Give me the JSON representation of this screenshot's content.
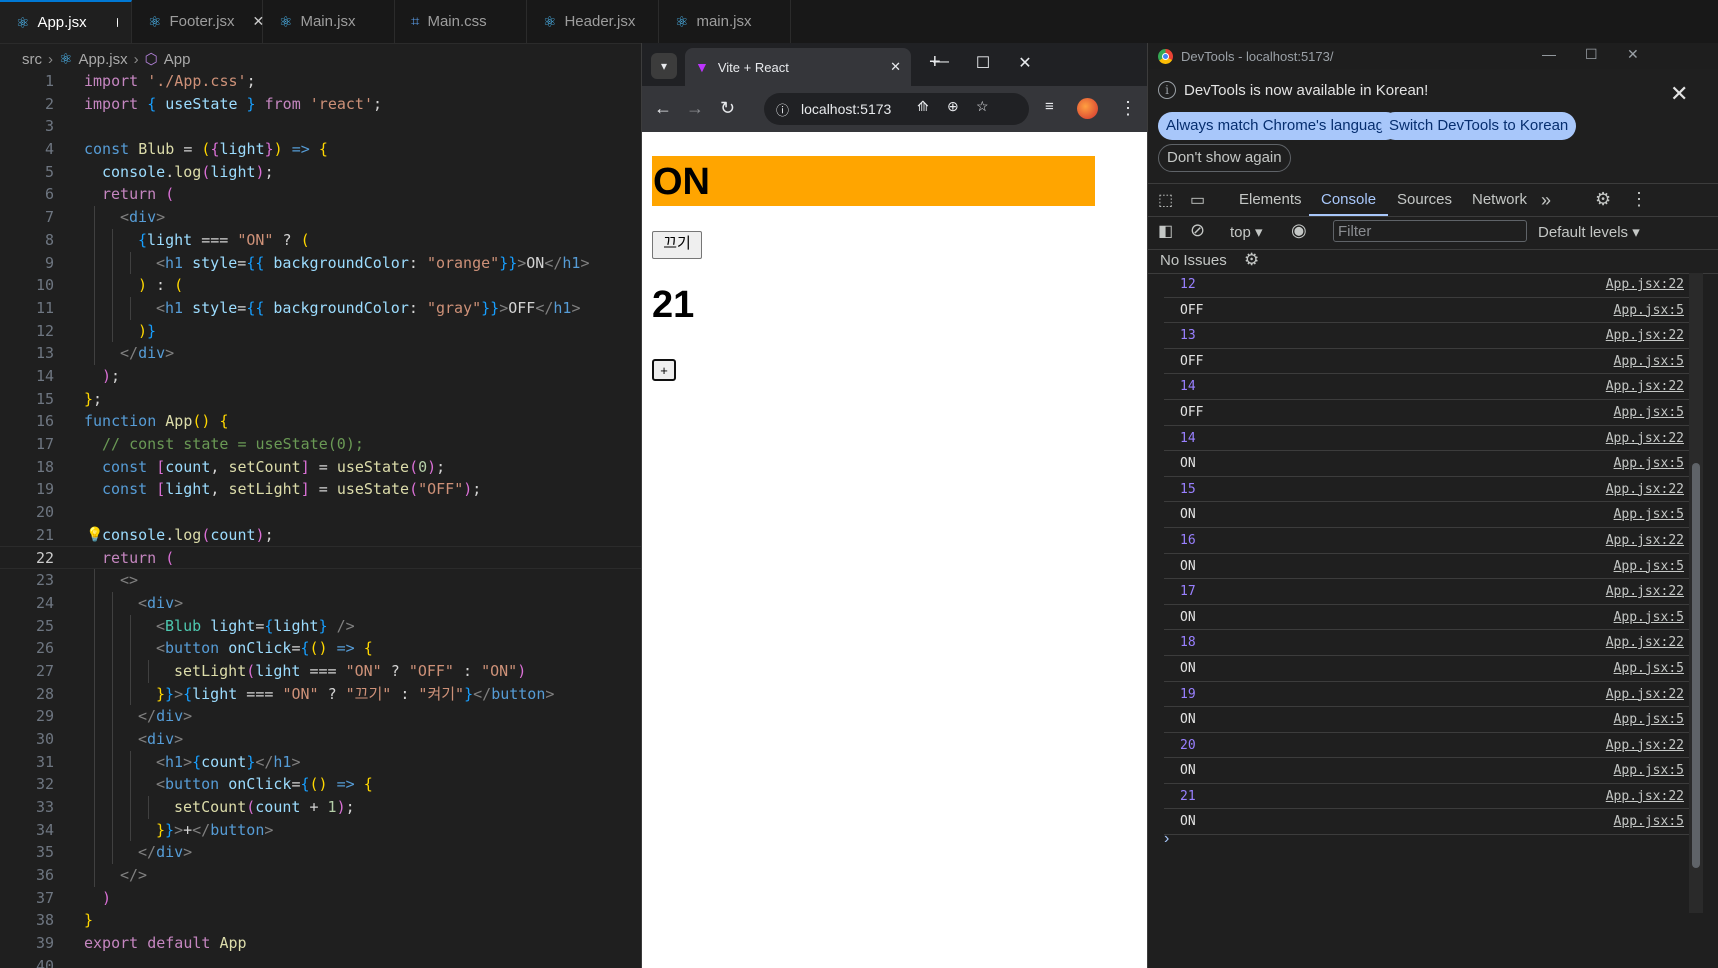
{
  "editor": {
    "tabs": [
      {
        "label": "App.jsx",
        "icon": "react-icon",
        "active": true,
        "modified": true
      },
      {
        "label": "Footer.jsx",
        "icon": "react-icon",
        "close": true
      },
      {
        "label": "Main.jsx",
        "icon": "react-icon"
      },
      {
        "label": "Main.css",
        "icon": "css-icon"
      },
      {
        "label": "Header.jsx",
        "icon": "react-icon"
      },
      {
        "label": "main.jsx",
        "icon": "react-icon"
      }
    ],
    "breadcrumb": {
      "folder": "src",
      "file": "App.jsx",
      "symbol": "App"
    },
    "current_line": 22,
    "lines": [
      {
        "n": 1,
        "i": 0,
        "t": [
          [
            "import ",
            "c"
          ],
          [
            "'./App.css'",
            "s"
          ],
          [
            ";",
            "d"
          ]
        ]
      },
      {
        "n": 2,
        "i": 0,
        "t": [
          [
            "import ",
            "c"
          ],
          [
            "{ ",
            "b"
          ],
          [
            "useState",
            "v"
          ],
          [
            " }",
            "b"
          ],
          [
            " from ",
            "c"
          ],
          [
            "'react'",
            "s"
          ],
          [
            ";",
            "d"
          ]
        ]
      },
      {
        "n": 3,
        "i": 0,
        "t": []
      },
      {
        "n": 4,
        "i": 0,
        "t": [
          [
            "const ",
            "k"
          ],
          [
            "Blub",
            "f"
          ],
          [
            " = ",
            "d"
          ],
          [
            "(",
            "p"
          ],
          [
            "{",
            "q"
          ],
          [
            "light",
            "v"
          ],
          [
            "}",
            "q"
          ],
          [
            ")",
            "p"
          ],
          [
            " => ",
            "k"
          ],
          [
            "{",
            "p"
          ]
        ]
      },
      {
        "n": 5,
        "i": 1,
        "t": [
          [
            "console",
            "v"
          ],
          [
            ".",
            "d"
          ],
          [
            "log",
            "f"
          ],
          [
            "(",
            "q"
          ],
          [
            "light",
            "v"
          ],
          [
            ")",
            "q"
          ],
          [
            ";",
            "d"
          ]
        ]
      },
      {
        "n": 6,
        "i": 1,
        "t": [
          [
            "return ",
            "c"
          ],
          [
            "(",
            "q"
          ]
        ]
      },
      {
        "n": 7,
        "i": 2,
        "t": [
          [
            "<",
            "g"
          ],
          [
            "div",
            "k"
          ],
          [
            ">",
            "g"
          ]
        ]
      },
      {
        "n": 8,
        "i": 3,
        "t": [
          [
            "{",
            "b"
          ],
          [
            "light",
            "v"
          ],
          [
            " === ",
            "d"
          ],
          [
            "\"ON\"",
            "s"
          ],
          [
            " ? ",
            "d"
          ],
          [
            "(",
            "p"
          ]
        ]
      },
      {
        "n": 9,
        "i": 4,
        "t": [
          [
            "<",
            "g"
          ],
          [
            "h1 ",
            "k"
          ],
          [
            "style",
            "v"
          ],
          [
            "=",
            "d"
          ],
          [
            "{{ ",
            "b"
          ],
          [
            "backgroundColor",
            "v"
          ],
          [
            ": ",
            "d"
          ],
          [
            "\"orange\"",
            "s"
          ],
          [
            "}}",
            "b"
          ],
          [
            ">",
            "g"
          ],
          [
            "ON",
            "d"
          ],
          [
            "</",
            "g"
          ],
          [
            "h1",
            "k"
          ],
          [
            ">",
            "g"
          ]
        ]
      },
      {
        "n": 10,
        "i": 3,
        "t": [
          [
            ")",
            "p"
          ],
          [
            " : ",
            "d"
          ],
          [
            "(",
            "p"
          ]
        ]
      },
      {
        "n": 11,
        "i": 4,
        "t": [
          [
            "<",
            "g"
          ],
          [
            "h1 ",
            "k"
          ],
          [
            "style",
            "v"
          ],
          [
            "=",
            "d"
          ],
          [
            "{{ ",
            "b"
          ],
          [
            "backgroundColor",
            "v"
          ],
          [
            ": ",
            "d"
          ],
          [
            "\"gray\"",
            "s"
          ],
          [
            "}}",
            "b"
          ],
          [
            ">",
            "g"
          ],
          [
            "OFF",
            "d"
          ],
          [
            "</",
            "g"
          ],
          [
            "h1",
            "k"
          ],
          [
            ">",
            "g"
          ]
        ]
      },
      {
        "n": 12,
        "i": 3,
        "t": [
          [
            ")",
            "p"
          ],
          [
            "}",
            "b"
          ]
        ]
      },
      {
        "n": 13,
        "i": 2,
        "t": [
          [
            "</",
            "g"
          ],
          [
            "div",
            "k"
          ],
          [
            ">",
            "g"
          ]
        ]
      },
      {
        "n": 14,
        "i": 1,
        "t": [
          [
            ")",
            "q"
          ],
          [
            ";",
            "d"
          ]
        ]
      },
      {
        "n": 15,
        "i": 0,
        "t": [
          [
            "}",
            "p"
          ],
          [
            ";",
            "d"
          ]
        ]
      },
      {
        "n": 16,
        "i": 0,
        "t": [
          [
            "function ",
            "k"
          ],
          [
            "App",
            "f"
          ],
          [
            "() ",
            "p"
          ],
          [
            "{",
            "p"
          ]
        ]
      },
      {
        "n": 17,
        "i": 1,
        "t": [
          [
            "// const state = useState(0);",
            "cm"
          ]
        ]
      },
      {
        "n": 18,
        "i": 1,
        "t": [
          [
            "const ",
            "k"
          ],
          [
            "[",
            "q"
          ],
          [
            "count",
            "v"
          ],
          [
            ", ",
            "d"
          ],
          [
            "setCount",
            "f"
          ],
          [
            "]",
            "q"
          ],
          [
            " = ",
            "d"
          ],
          [
            "useState",
            "f"
          ],
          [
            "(",
            "q"
          ],
          [
            "0",
            "n"
          ],
          [
            ")",
            "q"
          ],
          [
            ";",
            "d"
          ]
        ]
      },
      {
        "n": 19,
        "i": 1,
        "t": [
          [
            "const ",
            "k"
          ],
          [
            "[",
            "q"
          ],
          [
            "light",
            "v"
          ],
          [
            ", ",
            "d"
          ],
          [
            "setLight",
            "f"
          ],
          [
            "]",
            "q"
          ],
          [
            " = ",
            "d"
          ],
          [
            "useState",
            "f"
          ],
          [
            "(",
            "q"
          ],
          [
            "\"OFF\"",
            "s"
          ],
          [
            ")",
            "q"
          ],
          [
            ";",
            "d"
          ]
        ]
      },
      {
        "n": 20,
        "i": 0,
        "t": []
      },
      {
        "n": 21,
        "i": 1,
        "t": [
          [
            "console",
            "v"
          ],
          [
            ".",
            "d"
          ],
          [
            "log",
            "f"
          ],
          [
            "(",
            "q"
          ],
          [
            "count",
            "v"
          ],
          [
            ")",
            "q"
          ],
          [
            ";",
            "d"
          ]
        ],
        "bulb": true
      },
      {
        "n": 22,
        "i": 1,
        "t": [
          [
            "return ",
            "c"
          ],
          [
            "(",
            "q"
          ]
        ]
      },
      {
        "n": 23,
        "i": 2,
        "t": [
          [
            "<>",
            "g"
          ]
        ]
      },
      {
        "n": 24,
        "i": 3,
        "t": [
          [
            "<",
            "g"
          ],
          [
            "div",
            "k"
          ],
          [
            ">",
            "g"
          ]
        ]
      },
      {
        "n": 25,
        "i": 4,
        "t": [
          [
            "<",
            "g"
          ],
          [
            "Blub ",
            "t"
          ],
          [
            "light",
            "v"
          ],
          [
            "=",
            "d"
          ],
          [
            "{",
            "b"
          ],
          [
            "light",
            "v"
          ],
          [
            "}",
            "b"
          ],
          [
            " />",
            "g"
          ]
        ]
      },
      {
        "n": 26,
        "i": 4,
        "t": [
          [
            "<",
            "g"
          ],
          [
            "button ",
            "k"
          ],
          [
            "onClick",
            "v"
          ],
          [
            "=",
            "d"
          ],
          [
            "{",
            "b"
          ],
          [
            "() ",
            "p"
          ],
          [
            "=> ",
            "k"
          ],
          [
            "{",
            "p"
          ]
        ]
      },
      {
        "n": 27,
        "i": 5,
        "t": [
          [
            "setLight",
            "f"
          ],
          [
            "(",
            "q"
          ],
          [
            "light",
            "v"
          ],
          [
            " === ",
            "d"
          ],
          [
            "\"ON\"",
            "s"
          ],
          [
            " ? ",
            "d"
          ],
          [
            "\"OFF\"",
            "s"
          ],
          [
            " : ",
            "d"
          ],
          [
            "\"ON\"",
            "s"
          ],
          [
            ")",
            "q"
          ]
        ]
      },
      {
        "n": 28,
        "i": 4,
        "t": [
          [
            "}",
            "p"
          ],
          [
            "}",
            "b"
          ],
          [
            ">",
            "g"
          ],
          [
            "{",
            "b"
          ],
          [
            "light",
            "v"
          ],
          [
            " === ",
            "d"
          ],
          [
            "\"ON\"",
            "s"
          ],
          [
            " ? ",
            "d"
          ],
          [
            "\"끄기\"",
            "s"
          ],
          [
            " : ",
            "d"
          ],
          [
            "\"켜기\"",
            "s"
          ],
          [
            "}",
            "b"
          ],
          [
            "</",
            "g"
          ],
          [
            "button",
            "k"
          ],
          [
            ">",
            "g"
          ]
        ]
      },
      {
        "n": 29,
        "i": 3,
        "t": [
          [
            "</",
            "g"
          ],
          [
            "div",
            "k"
          ],
          [
            ">",
            "g"
          ]
        ]
      },
      {
        "n": 30,
        "i": 3,
        "t": [
          [
            "<",
            "g"
          ],
          [
            "div",
            "k"
          ],
          [
            ">",
            "g"
          ]
        ]
      },
      {
        "n": 31,
        "i": 4,
        "t": [
          [
            "<",
            "g"
          ],
          [
            "h1",
            "k"
          ],
          [
            ">",
            "g"
          ],
          [
            "{",
            "b"
          ],
          [
            "count",
            "v"
          ],
          [
            "}",
            "b"
          ],
          [
            "</",
            "g"
          ],
          [
            "h1",
            "k"
          ],
          [
            ">",
            "g"
          ]
        ]
      },
      {
        "n": 32,
        "i": 4,
        "t": [
          [
            "<",
            "g"
          ],
          [
            "button ",
            "k"
          ],
          [
            "onClick",
            "v"
          ],
          [
            "=",
            "d"
          ],
          [
            "{",
            "b"
          ],
          [
            "() ",
            "p"
          ],
          [
            "=> ",
            "k"
          ],
          [
            "{",
            "p"
          ]
        ]
      },
      {
        "n": 33,
        "i": 5,
        "t": [
          [
            "setCount",
            "f"
          ],
          [
            "(",
            "q"
          ],
          [
            "count",
            "v"
          ],
          [
            " + ",
            "d"
          ],
          [
            "1",
            "n"
          ],
          [
            ")",
            "q"
          ],
          [
            ";",
            "d"
          ]
        ]
      },
      {
        "n": 34,
        "i": 4,
        "t": [
          [
            "}",
            "p"
          ],
          [
            "}",
            "b"
          ],
          [
            ">",
            "g"
          ],
          [
            "+",
            "d"
          ],
          [
            "</",
            "g"
          ],
          [
            "button",
            "k"
          ],
          [
            ">",
            "g"
          ]
        ]
      },
      {
        "n": 35,
        "i": 3,
        "t": [
          [
            "</",
            "g"
          ],
          [
            "div",
            "k"
          ],
          [
            ">",
            "g"
          ]
        ]
      },
      {
        "n": 36,
        "i": 2,
        "t": [
          [
            "</>",
            "g"
          ]
        ]
      },
      {
        "n": 37,
        "i": 1,
        "t": [
          [
            ")",
            "q"
          ]
        ]
      },
      {
        "n": 38,
        "i": 0,
        "t": [
          [
            "}",
            "p"
          ]
        ]
      },
      {
        "n": 39,
        "i": 0,
        "t": [
          [
            "export ",
            "c"
          ],
          [
            "default ",
            "c"
          ],
          [
            "App",
            "f"
          ]
        ]
      },
      {
        "n": 40,
        "i": 0,
        "t": []
      }
    ]
  },
  "browser": {
    "tab_title": "Vite + React",
    "url": "localhost:5173",
    "page": {
      "heading": "ON",
      "toggle_label": "끄기",
      "count": "21",
      "plus_label": "+"
    }
  },
  "devtools": {
    "window_title": "DevTools - localhost:5173/",
    "info_text": "DevTools is now available in Korean!",
    "btn_match": "Always match Chrome's language",
    "btn_switch": "Switch DevTools to Korean",
    "btn_dont_show": "Don't show again",
    "tabs": {
      "elements": "Elements",
      "console": "Console",
      "sources": "Sources",
      "network": "Network",
      "more": "»"
    },
    "context": "top",
    "filter_placeholder": "Filter",
    "levels": "Default levels",
    "issues": "No Issues",
    "logs": [
      {
        "msg": "12",
        "src": "App.jsx:22",
        "num": true
      },
      {
        "msg": "OFF",
        "src": "App.jsx:5"
      },
      {
        "msg": "13",
        "src": "App.jsx:22",
        "num": true
      },
      {
        "msg": "OFF",
        "src": "App.jsx:5"
      },
      {
        "msg": "14",
        "src": "App.jsx:22",
        "num": true
      },
      {
        "msg": "OFF",
        "src": "App.jsx:5"
      },
      {
        "msg": "14",
        "src": "App.jsx:22",
        "num": true
      },
      {
        "msg": "ON",
        "src": "App.jsx:5"
      },
      {
        "msg": "15",
        "src": "App.jsx:22",
        "num": true
      },
      {
        "msg": "ON",
        "src": "App.jsx:5"
      },
      {
        "msg": "16",
        "src": "App.jsx:22",
        "num": true
      },
      {
        "msg": "ON",
        "src": "App.jsx:5"
      },
      {
        "msg": "17",
        "src": "App.jsx:22",
        "num": true
      },
      {
        "msg": "ON",
        "src": "App.jsx:5"
      },
      {
        "msg": "18",
        "src": "App.jsx:22",
        "num": true
      },
      {
        "msg": "ON",
        "src": "App.jsx:5"
      },
      {
        "msg": "19",
        "src": "App.jsx:22",
        "num": true
      },
      {
        "msg": "ON",
        "src": "App.jsx:5"
      },
      {
        "msg": "20",
        "src": "App.jsx:22",
        "num": true
      },
      {
        "msg": "ON",
        "src": "App.jsx:5"
      },
      {
        "msg": "21",
        "src": "App.jsx:22",
        "num": true
      },
      {
        "msg": "ON",
        "src": "App.jsx:5"
      }
    ],
    "prompt": "›"
  }
}
